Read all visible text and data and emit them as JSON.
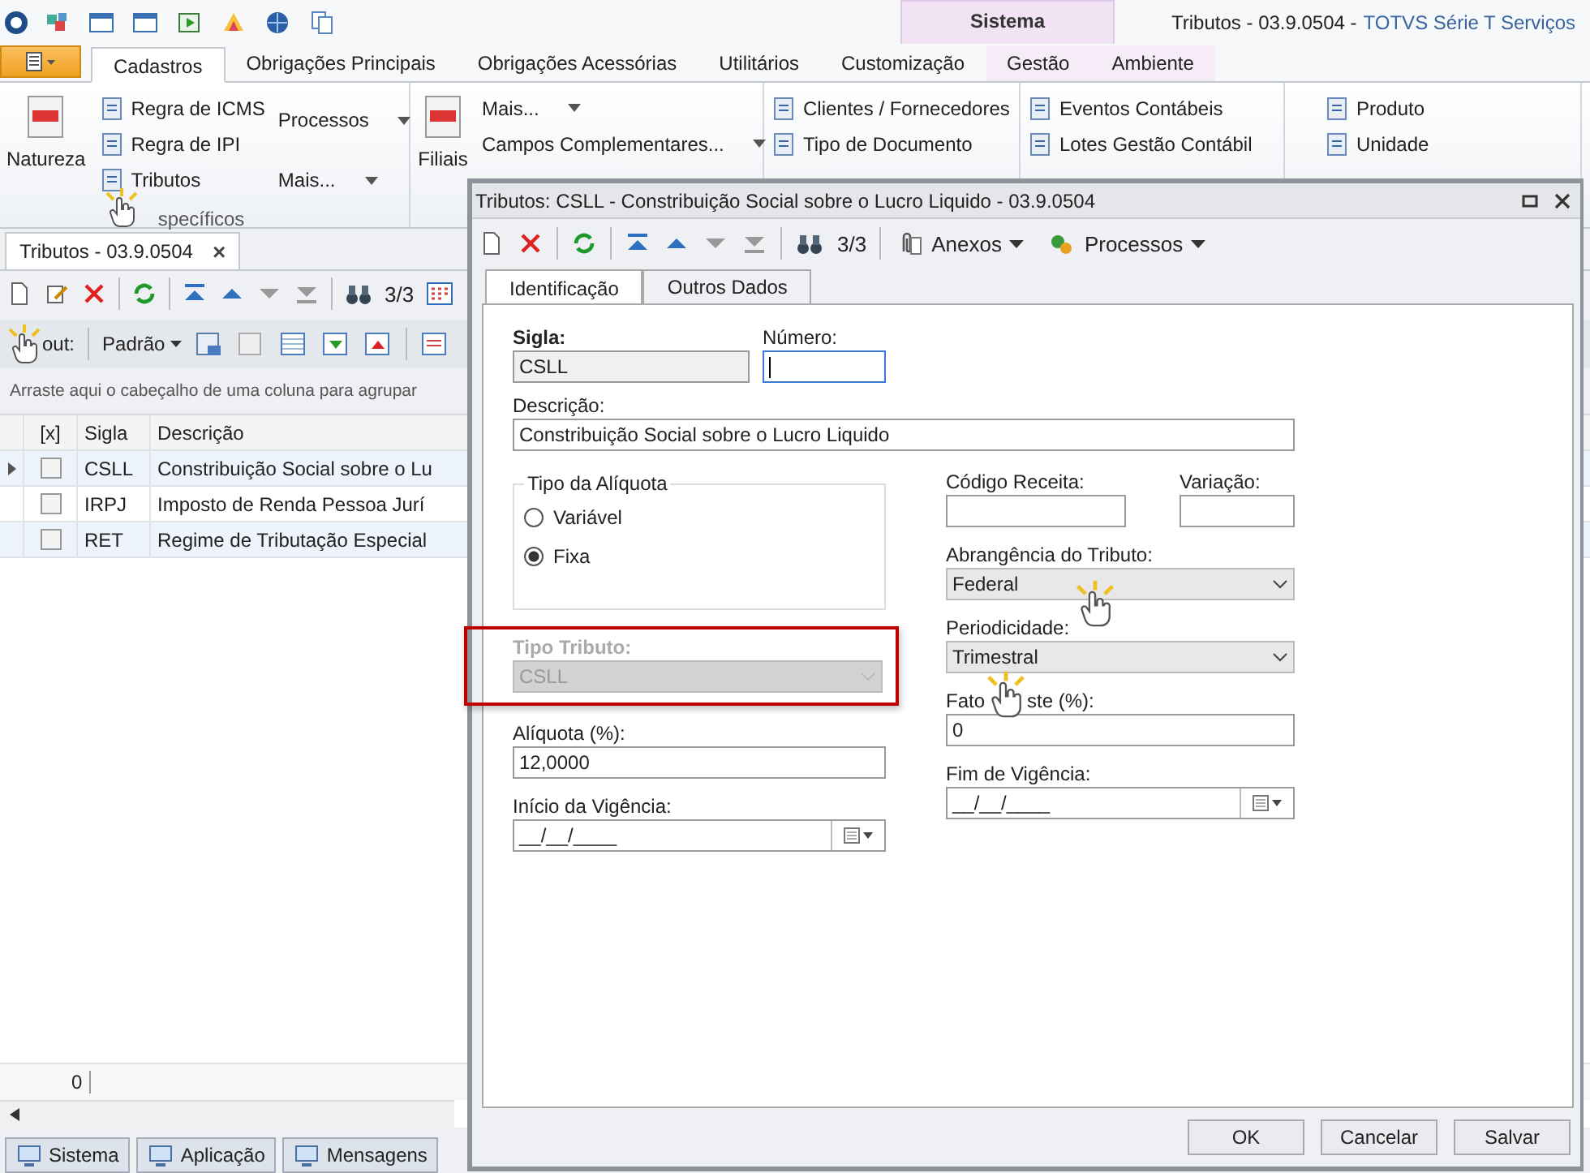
{
  "window": {
    "title": "Tributos - 03.9.0504 -",
    "app_name": "TOTVS Série T Serviços",
    "context_group": "Sistema"
  },
  "ribbon_tabs": [
    {
      "label": "Cadastros",
      "selected": true
    },
    {
      "label": "Obrigações Principais",
      "selected": false
    },
    {
      "label": "Obrigações Acessórias",
      "selected": false
    },
    {
      "label": "Utilitários",
      "selected": false
    },
    {
      "label": "Customização",
      "selected": false
    },
    {
      "label": "Gestão",
      "selected": false,
      "context": true
    },
    {
      "label": "Ambiente",
      "selected": false,
      "context": true
    }
  ],
  "ribbon_groups": [
    {
      "large": "Natureza",
      "columns": [
        [
          {
            "label": "Regra de ICMS"
          },
          {
            "label": "Regra de IPI"
          },
          {
            "label": "Tributos"
          }
        ],
        [
          {
            "label": "Processos",
            "menu": true
          },
          {
            "label": "Mais...",
            "menu": true
          }
        ]
      ],
      "label": "specíficos",
      "pointer": true
    },
    {
      "large": "Filiais",
      "columns": [
        [
          {
            "label": "Mais...",
            "menu": true
          },
          {
            "label": "Campos Complementares...",
            "menu": true
          }
        ]
      ]
    },
    {
      "columns": [
        [
          {
            "label": "Clientes / Fornecedores"
          },
          {
            "label": "Tipo de Documento"
          }
        ]
      ]
    },
    {
      "columns": [
        [
          {
            "label": "Eventos Contábeis"
          },
          {
            "label": "Lotes Gestão Contábil"
          }
        ]
      ]
    },
    {
      "columns": [
        [
          {
            "label": "Produto"
          },
          {
            "label": "Unidade"
          }
        ]
      ]
    }
  ],
  "document_tab": {
    "label": "Tributos - 03.9.0504",
    "close": "×"
  },
  "toolbar": {
    "counter": "3/3"
  },
  "layout_bar": {
    "label": "out:",
    "pointer": true,
    "preset": "Padrão"
  },
  "group_hint": "Arraste aqui o cabeçalho de uma coluna para agrupar",
  "grid": {
    "columns": [
      "[x]",
      "Sigla",
      "Descrição"
    ],
    "rows": [
      {
        "current": true,
        "checked": false,
        "sigla": "CSLL",
        "descricao": "Constribuição Social sobre o Lu"
      },
      {
        "current": false,
        "checked": false,
        "sigla": "IRPJ",
        "descricao": "Imposto de Renda Pessoa Jurí"
      },
      {
        "current": false,
        "checked": false,
        "sigla": "RET",
        "descricao": "Regime de Tributação Especial"
      }
    ],
    "footer": "0"
  },
  "bottom_tabs": [
    "Sistema",
    "Aplicação",
    "Mensagens"
  ],
  "dialog": {
    "title": "Tributos: CSLL - Constribuição Social sobre o Lucro Liquido - 03.9.0504",
    "counter": "3/3",
    "menus": [
      "Anexos",
      "Processos"
    ],
    "tabs": [
      {
        "label": "Identificação",
        "selected": true
      },
      {
        "label": "Outros Dados",
        "selected": false
      }
    ],
    "top": [
      {
        "kind": "text",
        "label": "Sigla:",
        "emphasis": true,
        "value": "CSLL",
        "readonly": true
      },
      {
        "kind": "text",
        "label": "Número:",
        "focused": true
      }
    ],
    "description": {
      "kind": "text",
      "label": "Descrição:",
      "value": "Constribuição Social sobre o Lucro Liquido"
    },
    "left": [
      {
        "kind": "radio_group",
        "label": "Tipo da Alíquota",
        "options": [
          {
            "label": "Variável",
            "selected": false
          },
          {
            "label": "Fixa",
            "selected": true
          }
        ]
      },
      {
        "kind": "select",
        "label": "Tipo Tributo:",
        "emphasis": true,
        "value": "CSLL",
        "disabled": true,
        "highlighted": true
      },
      {
        "kind": "text",
        "label": "Alíquota (%):",
        "value": "12,0000"
      },
      {
        "kind": "date",
        "label": "Início da Vigência:",
        "value": "__/__/____"
      }
    ],
    "right": [
      {
        "kind": "pair",
        "fields": [
          {
            "kind": "text",
            "label": "Código Receita:"
          },
          {
            "kind": "text",
            "label": "Variação:"
          }
        ]
      },
      {
        "kind": "select",
        "label": "Abrangência do Tributo:",
        "value": "Federal",
        "pointer": true
      },
      {
        "kind": "select",
        "label": "Periodicidade:",
        "value": "Trimestral"
      },
      {
        "kind": "text",
        "label": "Fato",
        "label_tail": "ste (%):",
        "pointer": true,
        "value": "0"
      },
      {
        "kind": "date",
        "label": "Fim de Vigência:",
        "value": "__/__/____"
      }
    ],
    "buttons": [
      "OK",
      "Cancelar",
      "Salvar"
    ]
  }
}
